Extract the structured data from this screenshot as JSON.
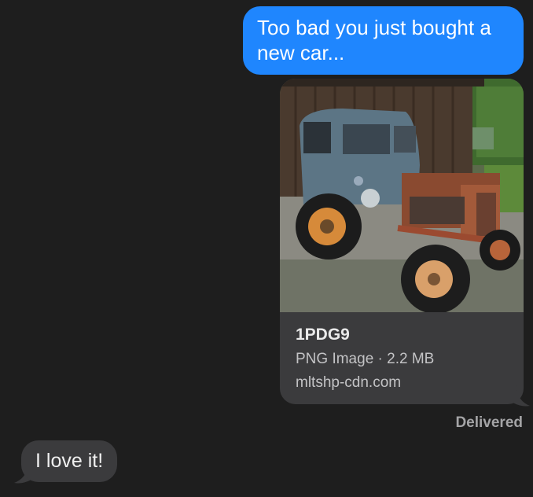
{
  "messages": {
    "outgoing_text": "Too bad you just bought a new car...",
    "link_preview": {
      "title": "1PDG9",
      "meta": "PNG Image · 2.2 MB",
      "domain": "mltshp-cdn.com",
      "image_alt": "rusty old tractor with car cab"
    },
    "status": "Delivered",
    "incoming_text": "I love it!"
  },
  "colors": {
    "outgoing_bubble": "#1f86fe",
    "incoming_bubble": "#3b3b3d",
    "background": "#1e1e1e"
  }
}
